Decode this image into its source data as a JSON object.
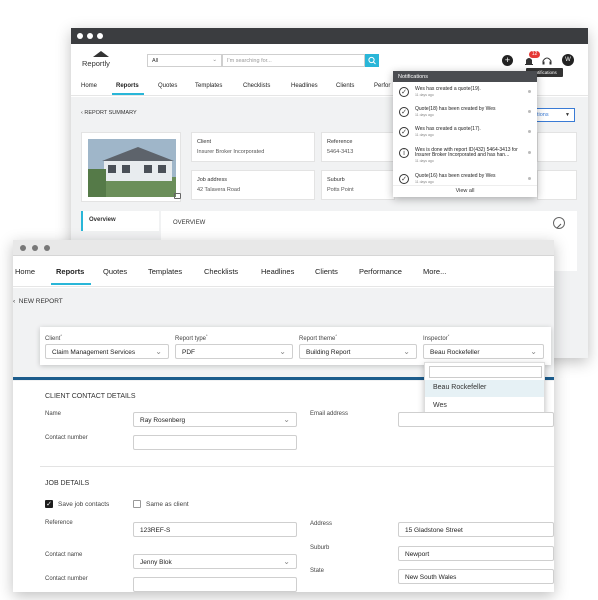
{
  "back_window": {
    "logo": "Reportly",
    "search": {
      "filter_value": "All",
      "placeholder": "I'm searching for..."
    },
    "notif_badge": "12",
    "avatar": "W",
    "tooltip": "Notifications",
    "nav": [
      "Home",
      "Reports",
      "Quotes",
      "Templates",
      "Checklists",
      "Headlines",
      "Clients",
      "Perfor"
    ],
    "breadcrumb": "REPORT SUMMARY",
    "actions_label": "tions",
    "info": {
      "client_label": "Client",
      "client_value": "Insurer Broker Incorporated",
      "reference_label": "Reference",
      "reference_value": "5464-3413",
      "job_address_label": "Job address",
      "job_address_value": "42 Talavera Road",
      "suburb_label": "Suburb",
      "suburb_value": "Potts Point"
    },
    "sidebar_overview": "Overview",
    "overview_title": "OVERVIEW",
    "notifications": {
      "title": "Notifications",
      "items": [
        {
          "text": "Wes has created a quote(19).",
          "text2": "",
          "time": "11 days ago",
          "icon": "check"
        },
        {
          "text": "Quote(18) has been created by Wes",
          "text2": "",
          "time": "11 days ago",
          "icon": "check"
        },
        {
          "text": "Wes has created a quote(17).",
          "text2": "",
          "time": "11 days ago",
          "icon": "check"
        },
        {
          "text": "Wes is done with report ID(432) 5464-3413 for",
          "text2": "Insurer Broker Incorporated and has han...",
          "time": "11 days ago",
          "icon": "info"
        },
        {
          "text": "Quote(16) has been created by Wes",
          "text2": "",
          "time": "11 days ago",
          "icon": "check"
        }
      ],
      "view_all": "View all"
    }
  },
  "front_window": {
    "nav": [
      "Home",
      "Reports",
      "Quotes",
      "Templates",
      "Checklists",
      "Headlines",
      "Clients",
      "Performance",
      "More..."
    ],
    "breadcrumb": "NEW REPORT",
    "form": {
      "client_label": "Client",
      "client_value": "Claim Management Services",
      "report_type_label": "Report type",
      "report_type_value": "PDF",
      "report_theme_label": "Report theme",
      "report_theme_value": "Building Report",
      "inspector_label": "Inspector",
      "inspector_value": "Beau Rockefeller",
      "inspector_options": [
        "Beau Rockefeller",
        "Wes"
      ],
      "required_mark": "*"
    },
    "client_contact": {
      "title": "CLIENT CONTACT DETAILS",
      "name_label": "Name",
      "name_value": "Ray Rosenberg",
      "email_label": "Email address",
      "contact_number_label": "Contact number"
    },
    "job_details": {
      "title": "JOB DETAILS",
      "save_job_contacts": "Save job contacts",
      "same_as_client": "Same as client",
      "reference_label": "Reference",
      "reference_value": "123REF-S",
      "contact_name_label": "Contact name",
      "contact_name_value": "Jenny Blok",
      "contact_number_label": "Contact number",
      "address_label": "Address",
      "address_value": "15 Gladstone Street",
      "suburb_label": "Suburb",
      "suburb_value": "Newport",
      "state_label": "State",
      "state_value": "New South Wales"
    }
  },
  "colors": {
    "accent": "#29b6d8",
    "badge": "#e53935",
    "titlebar_dark": "#3b3d40",
    "notif_header": "#4a4c50"
  }
}
